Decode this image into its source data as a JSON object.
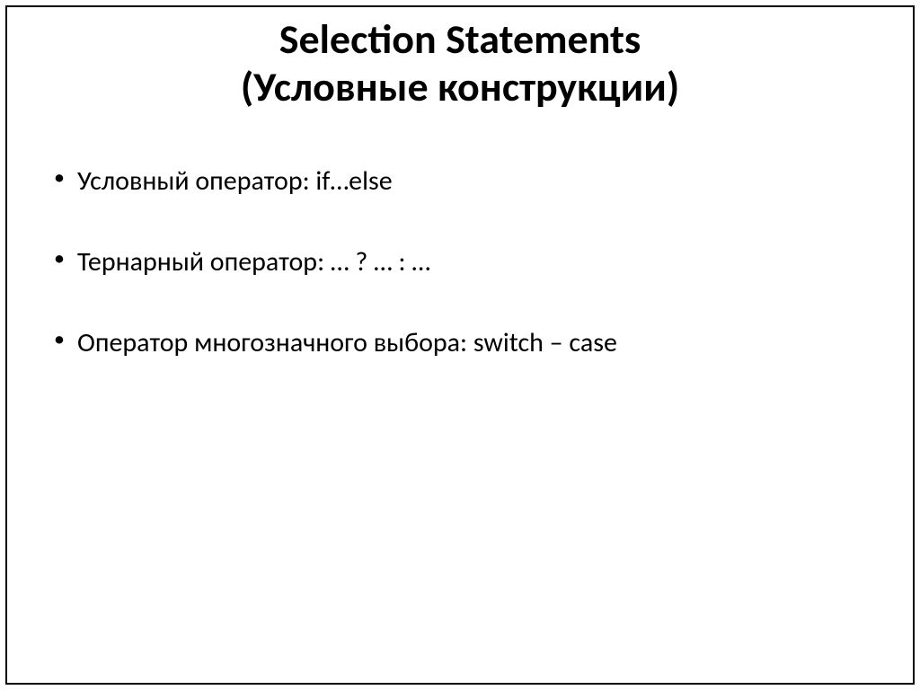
{
  "slide": {
    "title_line1": "Selection Statements",
    "title_line2": "(Условные конструкции)",
    "bullets": [
      "Условный оператор: if…else",
      "Тернарный оператор: … ? … : …",
      "Оператор многозначного выбора: switch – case"
    ]
  }
}
